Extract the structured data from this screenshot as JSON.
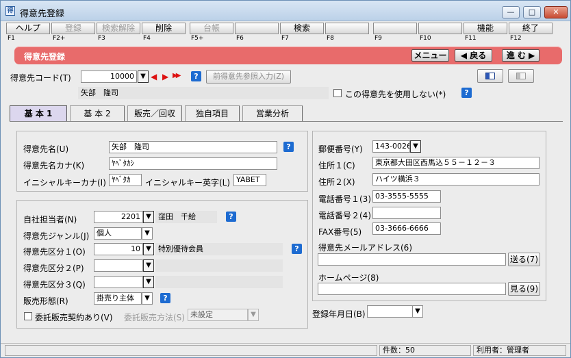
{
  "window": {
    "title": "得意先登録",
    "min": "—",
    "max": "□",
    "close": "✕"
  },
  "fkeys": [
    {
      "label": "ヘルプ",
      "key": "F1",
      "enabled": true
    },
    {
      "label": "登録",
      "key": "F2+",
      "enabled": false
    },
    {
      "label": "検索解除",
      "key": "F3",
      "enabled": false
    },
    {
      "label": "削除",
      "key": "F4",
      "enabled": true
    },
    {
      "label": "台帳",
      "key": "F5+",
      "enabled": false
    },
    {
      "label": "",
      "key": "F6",
      "enabled": false
    },
    {
      "label": "検索",
      "key": "F7",
      "enabled": true
    },
    {
      "label": "",
      "key": "F8",
      "enabled": false
    },
    {
      "label": "",
      "key": "F9",
      "enabled": false
    },
    {
      "label": "",
      "key": "F10",
      "enabled": false
    },
    {
      "label": "機能",
      "key": "F11",
      "enabled": true
    },
    {
      "label": "終了",
      "key": "F12",
      "enabled": true
    }
  ],
  "banner": {
    "title": "得意先登録",
    "menu": "メニュー",
    "back": "◀ 戻る",
    "next": "進 む ▶"
  },
  "header": {
    "code_label": "得意先コード(T)",
    "code_value": "10000",
    "prev_ref": "前得意先参照入力(Z)",
    "name_display": "矢部　隆司",
    "unused_label": "この得意先を使用しない(*)"
  },
  "tabs": [
    "基 本 1",
    "基 本 2",
    "販売／回収",
    "独自項目",
    "営業分析"
  ],
  "basic": {
    "name_label": "得意先名(U)",
    "name_value": "矢部　隆司",
    "kana_label": "得意先名カナ(K)",
    "kana_value": "ﾔﾍﾞﾀｶｼ",
    "initial_kana_label": "イニシャルキーカナ(I)",
    "initial_kana_value": "ﾔﾍﾞﾀｶ",
    "initial_en_label": "イニシャルキー英字(L)",
    "initial_en_value": "YABET"
  },
  "sales": {
    "staff_label": "自社担当者(N)",
    "staff_code": "2201",
    "staff_name": "窪田　千絵",
    "genre_label": "得意先ジャンル(J)",
    "genre_value": "個人",
    "class1_label": "得意先区分１(O)",
    "class1_code": "10",
    "class1_name": "特別優待会員",
    "class2_label": "得意先区分２(P)",
    "class3_label": "得意先区分３(Q)",
    "form_label": "販売形態(R)",
    "form_value": "掛売り主体",
    "consign_label": "委託販売契約あり(V)",
    "consign_method_label": "委託販売方法(S)",
    "consign_method_value": "未設定"
  },
  "address": {
    "zip_label": "郵便番号(Y)",
    "zip_value": "143-0026",
    "addr1_label": "住所１(C)",
    "addr1_value": "東京都大田区西馬込５５－１２－３",
    "addr2_label": "住所２(X)",
    "addr2_value": "ハイツ横浜３",
    "tel1_label": "電話番号１(3)",
    "tel1_value": "03-3555-5555",
    "tel2_label": "電話番号２(4)",
    "tel2_value": "",
    "fax_label": "FAX番号(5)",
    "fax_value": "03-3666-6666",
    "mail_label": "得意先メールアドレス(6)",
    "mail_btn": "送る(7)",
    "hp_label": "ホームページ(8)",
    "hp_btn": "見る(9)",
    "reg_date_label": "登録年月日(B)"
  },
  "status": {
    "count": "件数：50",
    "user": "利用者：管理者"
  },
  "icons": {
    "help": "?",
    "dropdown": "▼",
    "nav_prev": "◀",
    "nav_next": "▶",
    "nav_last": "▶▶"
  }
}
